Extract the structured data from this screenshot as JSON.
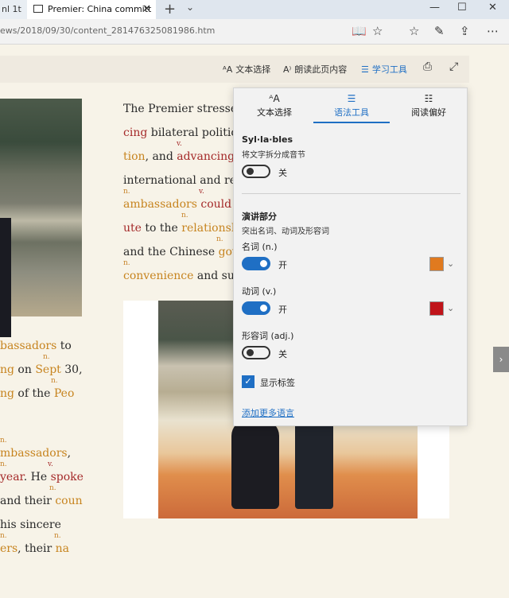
{
  "browser": {
    "prev_tab": "nl 1t",
    "active_tab": "Premier: China committ",
    "url": "ews/2018/09/30/content_281476325081986.htm"
  },
  "reader_toolbar": {
    "text_select": "文本选择",
    "read_aloud": "朗读此页内容",
    "learning_tools": "学习工具"
  },
  "article": {
    "right_lines": [
      {
        "pre": "The Premier stresse",
        "hl": "",
        "post": "",
        "cls": ""
      },
      {
        "pre": "",
        "hl": "cing",
        "post": " bilateral politic",
        "cls": "verb"
      },
      {
        "pre": "",
        "hl": "tion",
        "post": ", and ",
        "cls": "noun",
        "hl2": "advancing",
        "cls2": "verb"
      },
      {
        "pre": "international and re",
        "hl": "",
        "post": "",
        "cls": ""
      },
      {
        "pre": "",
        "hl": "ambassadors",
        "post": " ",
        "cls": "noun",
        "hl2": "could",
        "cls2": "verb"
      },
      {
        "pre": "",
        "hl": "ute",
        "post": " to the ",
        "cls": "verb",
        "hl2": "relationsh",
        "cls2": "noun"
      },
      {
        "pre": "and the Chinese ",
        "hl": "gov",
        "post": "",
        "cls": "noun"
      },
      {
        "pre": "",
        "hl": "convenience",
        "post": " and su",
        "cls": "noun"
      }
    ],
    "left_lines": [
      {
        "pre": "",
        "hl": "bassadors",
        "post": " to",
        "cls": "noun"
      },
      {
        "pre": "",
        "hl": "ng",
        "post": " on ",
        "cls": "noun",
        "hl2": "Sept",
        "cls2": "noun",
        "post2": " 30,"
      },
      {
        "pre": "",
        "hl": "ng",
        "post": " of the ",
        "cls": "noun",
        "hl2": "Peo",
        "cls2": "noun",
        "post2": ""
      },
      {
        "pre": "",
        "hl": "mbassadors",
        "post": ",",
        "cls": "noun"
      },
      {
        "pre": "",
        "hl": "year",
        "post": ". He ",
        "cls": "verb",
        "hl2": "spoke",
        "cls2": "verb",
        "post2": ""
      },
      {
        "pre": "and their ",
        "hl": "coun",
        "post": "",
        "cls": "noun"
      },
      {
        "pre": " his sincere",
        "hl": "",
        "post": "",
        "cls": ""
      },
      {
        "pre": "",
        "hl": "ers",
        "post": ", their ",
        "cls": "noun",
        "hl2": "na",
        "cls2": "noun",
        "post2": ""
      }
    ],
    "tags": {
      "n": "n.",
      "v": "v."
    }
  },
  "panel": {
    "tabs": [
      "文本选择",
      "语法工具",
      "阅读偏好"
    ],
    "syllables_title": "Syl·la·bles",
    "syllables_sub": "将文字拆分成音节",
    "syllables_state": "关",
    "pos_title": "演讲部分",
    "pos_sub": "突出名词、动词及形容词",
    "noun_label": "名词 (n.)",
    "noun_state": "开",
    "noun_color": "#e07a1f",
    "verb_label": "动词 (v.)",
    "verb_state": "开",
    "verb_color": "#c0141a",
    "adj_label": "形容词 (adj.)",
    "adj_state": "关",
    "show_labels": "显示标签",
    "add_languages": "添加更多语言"
  }
}
